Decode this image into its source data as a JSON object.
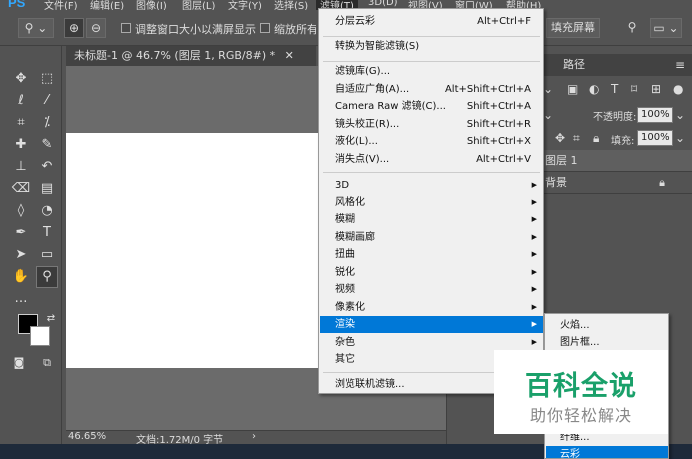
{
  "app": {
    "logo": "PS"
  },
  "menubar": {
    "items": [
      {
        "label": "文件(F)"
      },
      {
        "label": "编辑(E)"
      },
      {
        "label": "图像(I)"
      },
      {
        "label": "图层(L)"
      },
      {
        "label": "文字(Y)"
      },
      {
        "label": "选择(S)"
      },
      {
        "label": "滤镜(T)"
      },
      {
        "label": "3D(D)"
      },
      {
        "label": "视图(V)"
      },
      {
        "label": "窗口(W)"
      },
      {
        "label": "帮助(H)"
      }
    ]
  },
  "options": {
    "resize_windows_label": "调整窗口大小以满屏显示",
    "zoom_all_label": "缩放所有窗口",
    "fill_screen_label": "填充屏幕"
  },
  "document": {
    "tab_title": "未标题-1 @ 46.7% (图层 1, RGB/8#) *",
    "zoom": "46.65%",
    "doc_info": "文档:1.72M/0 字节"
  },
  "panels": {
    "paths_tab": "路径",
    "opacity_label": "不透明度:",
    "opacity_value": "100%",
    "fill_label": "填充:",
    "fill_value": "100%",
    "layers": [
      {
        "name": "图层 1"
      },
      {
        "name": "背景"
      }
    ]
  },
  "filter_menu": {
    "groups": [
      [
        {
          "label": "分层云彩",
          "shortcut": "Alt+Ctrl+F"
        }
      ],
      [
        {
          "label": "转换为智能滤镜(S)",
          "shortcut": ""
        }
      ],
      [
        {
          "label": "滤镜库(G)...",
          "shortcut": ""
        },
        {
          "label": "自适应广角(A)...",
          "shortcut": "Alt+Shift+Ctrl+A"
        },
        {
          "label": "Camera Raw 滤镜(C)...",
          "shortcut": "Shift+Ctrl+A"
        },
        {
          "label": "镜头校正(R)...",
          "shortcut": "Shift+Ctrl+R"
        },
        {
          "label": "液化(L)...",
          "shortcut": "Shift+Ctrl+X"
        },
        {
          "label": "消失点(V)...",
          "shortcut": "Alt+Ctrl+V"
        }
      ],
      [
        {
          "label": "3D",
          "sub": true
        },
        {
          "label": "风格化",
          "sub": true
        },
        {
          "label": "模糊",
          "sub": true
        },
        {
          "label": "模糊画廊",
          "sub": true
        },
        {
          "label": "扭曲",
          "sub": true
        },
        {
          "label": "锐化",
          "sub": true
        },
        {
          "label": "视频",
          "sub": true
        },
        {
          "label": "像素化",
          "sub": true
        },
        {
          "label": "渲染",
          "sub": true,
          "highlighted": true
        },
        {
          "label": "杂色",
          "sub": true
        },
        {
          "label": "其它",
          "sub": true
        }
      ],
      [
        {
          "label": "浏览联机滤镜...",
          "shortcut": ""
        }
      ]
    ]
  },
  "render_submenu": {
    "items": [
      {
        "label": "火焰..."
      },
      {
        "label": "图片框..."
      },
      {
        "label": "纤维..."
      },
      {
        "label": "云彩",
        "highlighted": true
      }
    ]
  },
  "watermark": {
    "title": "百科全说",
    "subtitle": "助你轻松解决"
  },
  "colors": {
    "highlight": "#0078d7",
    "ui_bg": "#535353",
    "watermark_green": "#1aa06a"
  }
}
